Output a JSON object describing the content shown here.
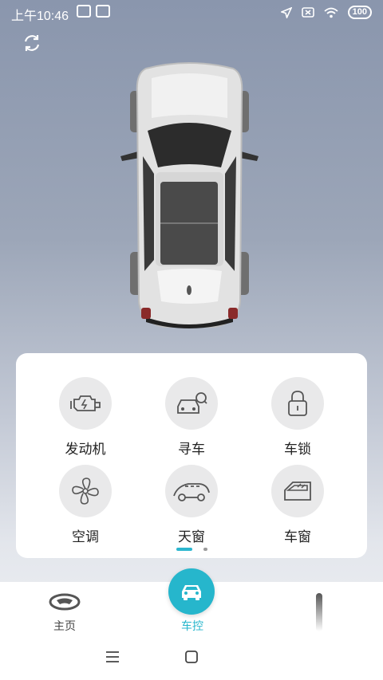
{
  "status_bar": {
    "time": "上午10:46",
    "battery": "100"
  },
  "controls": [
    {
      "label": "发动机",
      "icon": "engine-icon"
    },
    {
      "label": "寻车",
      "icon": "find-car-icon"
    },
    {
      "label": "车锁",
      "icon": "lock-icon"
    },
    {
      "label": "空调",
      "icon": "fan-icon"
    },
    {
      "label": "天窗",
      "icon": "sunroof-icon"
    },
    {
      "label": "车窗",
      "icon": "window-icon"
    }
  ],
  "pager": {
    "pages": 2,
    "active": 1
  },
  "bottom_nav": {
    "home_label": "主页",
    "control_label": "车控"
  },
  "colors": {
    "accent": "#26b6cc",
    "icon_bg": "#e9e9ea",
    "icon_stroke": "#555555"
  }
}
